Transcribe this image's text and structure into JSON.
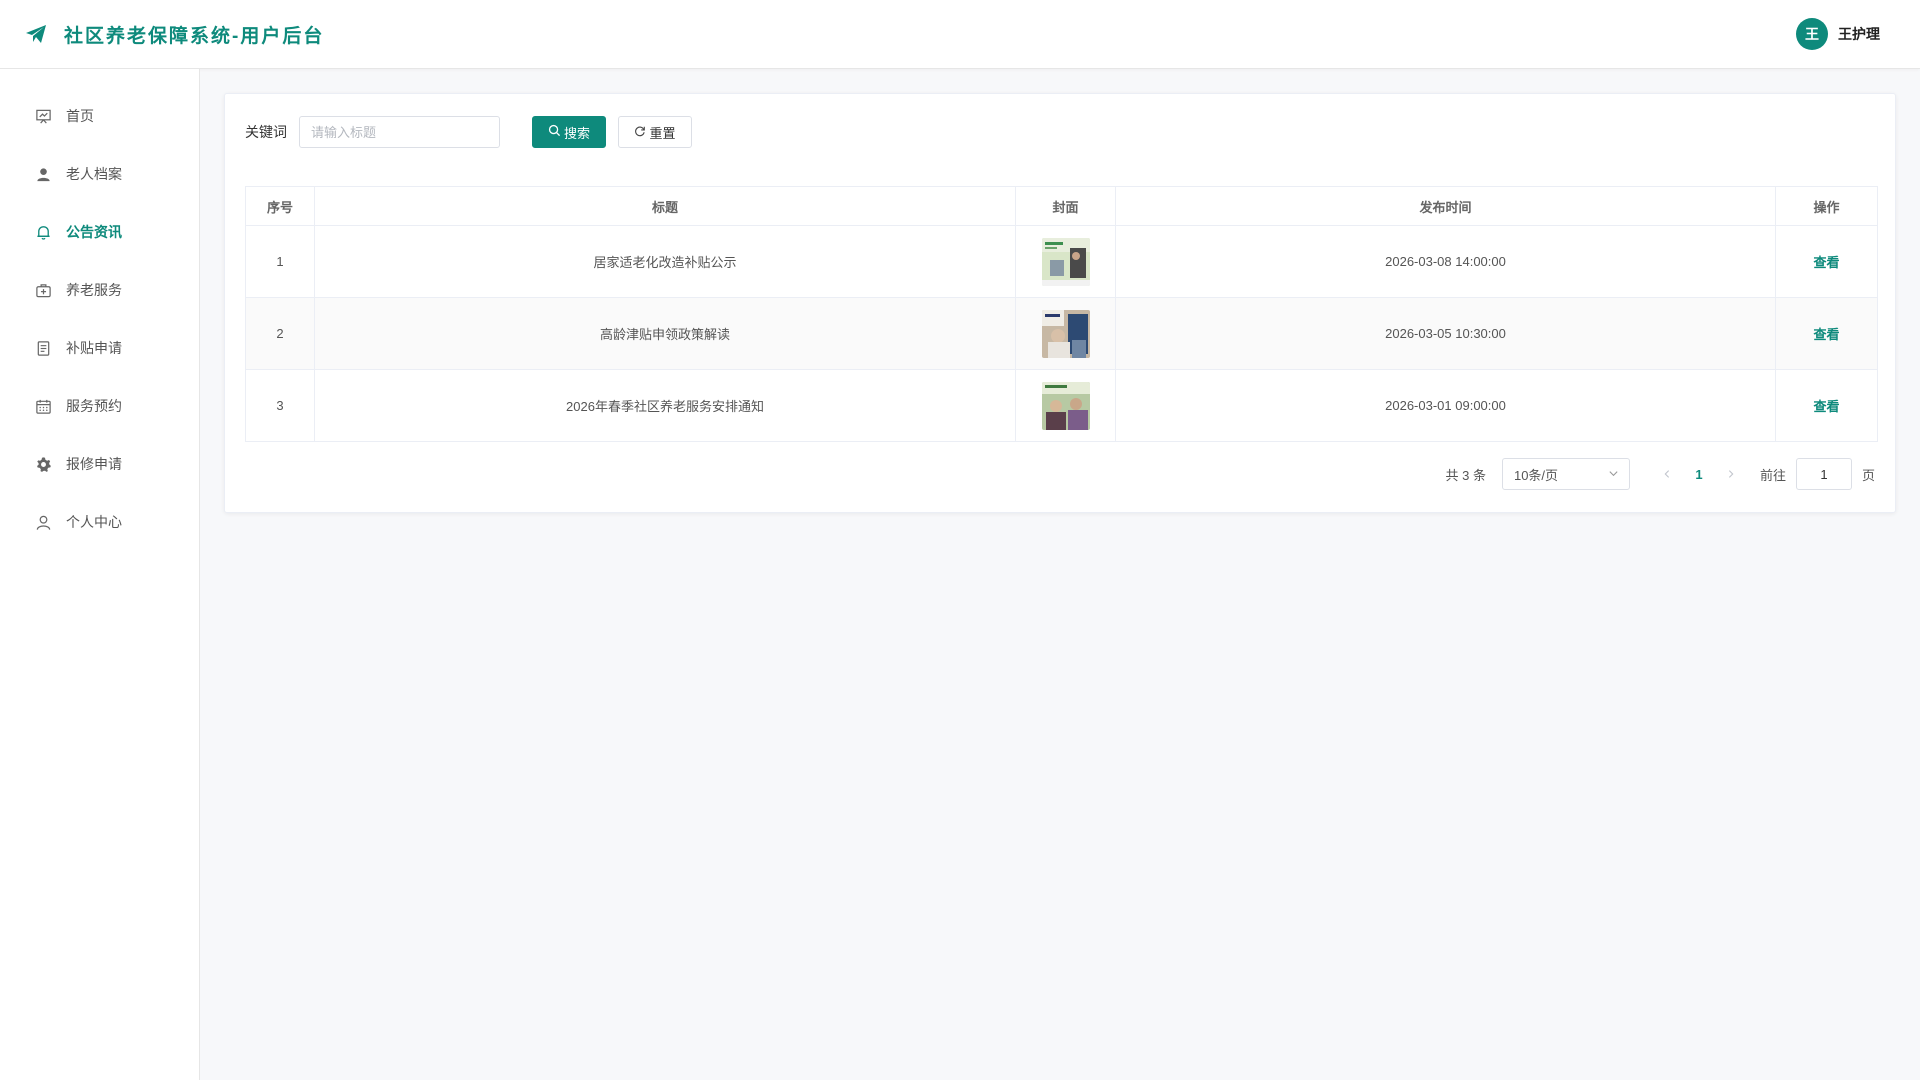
{
  "header": {
    "title": "社区养老保障系统-用户后台",
    "user": {
      "avatar_letter": "王",
      "name": "王护理"
    },
    "brand_color": "#0e8a7c"
  },
  "sidebar": {
    "items": [
      {
        "label": "首页",
        "icon": "presentation-icon",
        "active": false
      },
      {
        "label": "老人档案",
        "icon": "user-icon",
        "active": false
      },
      {
        "label": "公告资讯",
        "icon": "bell-icon",
        "active": true
      },
      {
        "label": "养老服务",
        "icon": "medical-box-icon",
        "active": false
      },
      {
        "label": "补贴申请",
        "icon": "document-icon",
        "active": false
      },
      {
        "label": "服务预约",
        "icon": "calendar-icon",
        "active": false
      },
      {
        "label": "报修申请",
        "icon": "gear-icon",
        "active": false
      },
      {
        "label": "个人中心",
        "icon": "person-outline-icon",
        "active": false
      }
    ]
  },
  "search": {
    "label": "关键词",
    "placeholder": "请输入标题",
    "value": "",
    "search_button": "搜索",
    "reset_button": "重置"
  },
  "table": {
    "columns": [
      "序号",
      "标题",
      "封面",
      "发布时间",
      "操作"
    ],
    "rows": [
      {
        "index": "1",
        "title": "居家适老化改造补贴公示",
        "published": "2026-03-08 14:00:00",
        "action": "查看"
      },
      {
        "index": "2",
        "title": "高龄津贴申领政策解读",
        "published": "2026-03-05 10:30:00",
        "action": "查看"
      },
      {
        "index": "3",
        "title": "2026年春季社区养老服务安排通知",
        "published": "2026-03-01 09:00:00",
        "action": "查看"
      }
    ]
  },
  "pagination": {
    "total_text": "共 3 条",
    "page_size": "10条/页",
    "current_page": "1",
    "goto_label": "前往",
    "goto_value": "1",
    "page_unit": "页"
  }
}
